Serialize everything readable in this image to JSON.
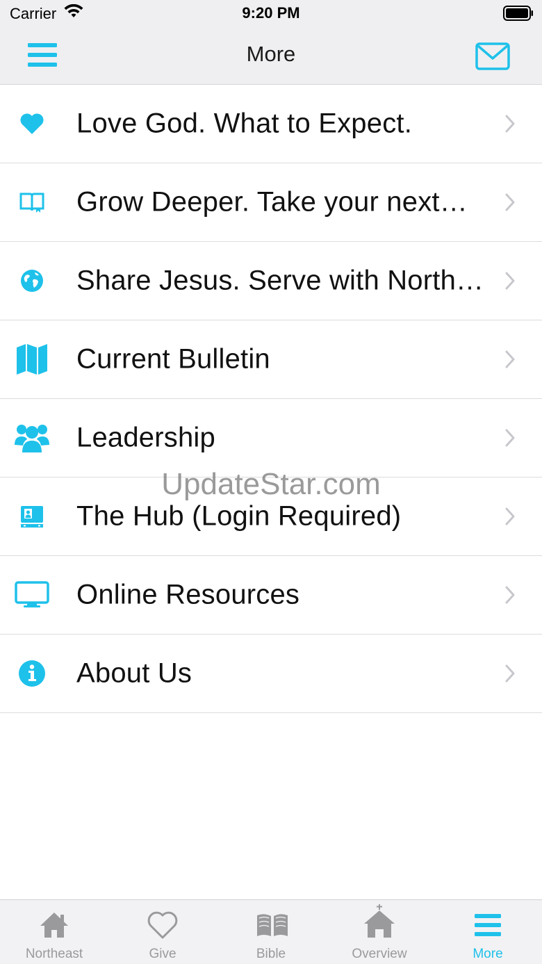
{
  "status_bar": {
    "carrier": "Carrier",
    "time": "9:20 PM"
  },
  "nav": {
    "title": "More",
    "left_icon": "menu-icon",
    "right_icon": "mail-icon"
  },
  "colors": {
    "accent": "#1ec1ea",
    "inactive": "#9a9a9c"
  },
  "menu_items": [
    {
      "label": "Love God. What to Expect.",
      "icon": "heart-icon"
    },
    {
      "label": "Grow Deeper. Take your next…",
      "icon": "book-icon"
    },
    {
      "label": "Share Jesus. Serve with North…",
      "icon": "globe-icon"
    },
    {
      "label": "Current Bulletin",
      "icon": "map-icon"
    },
    {
      "label": "Leadership",
      "icon": "people-icon"
    },
    {
      "label": "The Hub (Login Required)",
      "icon": "id-card-icon"
    },
    {
      "label": "Online Resources",
      "icon": "monitor-icon"
    },
    {
      "label": "About Us",
      "icon": "info-icon"
    }
  ],
  "watermark": "UpdateStar.com",
  "tabs": [
    {
      "label": "Northeast",
      "icon": "home-icon",
      "active": false
    },
    {
      "label": "Give",
      "icon": "heart-outline-icon",
      "active": false
    },
    {
      "label": "Bible",
      "icon": "bible-icon",
      "active": false
    },
    {
      "label": "Overview",
      "icon": "church-icon",
      "active": false
    },
    {
      "label": "More",
      "icon": "menu-icon",
      "active": true
    }
  ]
}
